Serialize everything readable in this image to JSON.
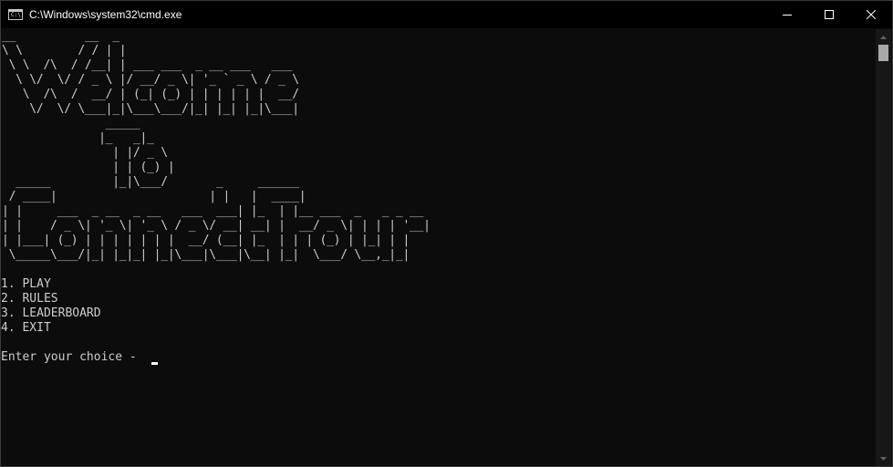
{
  "window": {
    "title": "C:\\Windows\\system32\\cmd.exe",
    "icon": "cmd-console-icon",
    "icon_text": "C:\\",
    "controls": [
      "minimize-icon",
      "maximize-icon",
      "close-icon"
    ]
  },
  "console": {
    "banner": "__          __  _                          \n\\ \\        / / | |                         \n \\ \\  /\\  / /__| | ___ ___  _ __ ___   ___ \n  \\ \\/  \\/ / _ \\ |/ __/ _ \\| '_ ` _ \\ / _ \\\n   \\  /\\  /  __/ | (_| (_) | | | | | |  __/\n    \\/  \\/ \\___|_|\\___\\___/|_| |_| |_|\\___|\n               _____                       \n              |_   _|_                     \n                | |/ _ \\                   \n                | | (_) |                  \n  _____         |_|\\___/       _     ______               \n / ____|                      | |   |  ____|              \n| |     ___  _ __  _ __   ___  ___| |_  | |__ ___  _   _ _ __ \n| |    / _ \\| '_ \\| '_ \\ / _ \\/ __| __| |  __/ _ \\| | | | '__|\n| |___| (_) | | | | | | |  __/ (__| |_  | | | (_) | |_| | |   \n \\_____\\___/|_| |_|_| |_|\\___|\\___|\\__| |_|  \\___/ \\__,_|_|   ",
    "menu": [
      "1. PLAY",
      "2. RULES",
      "3. LEADERBOARD",
      "4. EXIT"
    ],
    "prompt": "Enter your choice - "
  },
  "colors": {
    "background": "#0c0c0c",
    "text": "#cccccc",
    "titlebar": "#000000",
    "scrollbar_track": "#171717",
    "scrollbar_thumb": "#a8a8a8"
  }
}
